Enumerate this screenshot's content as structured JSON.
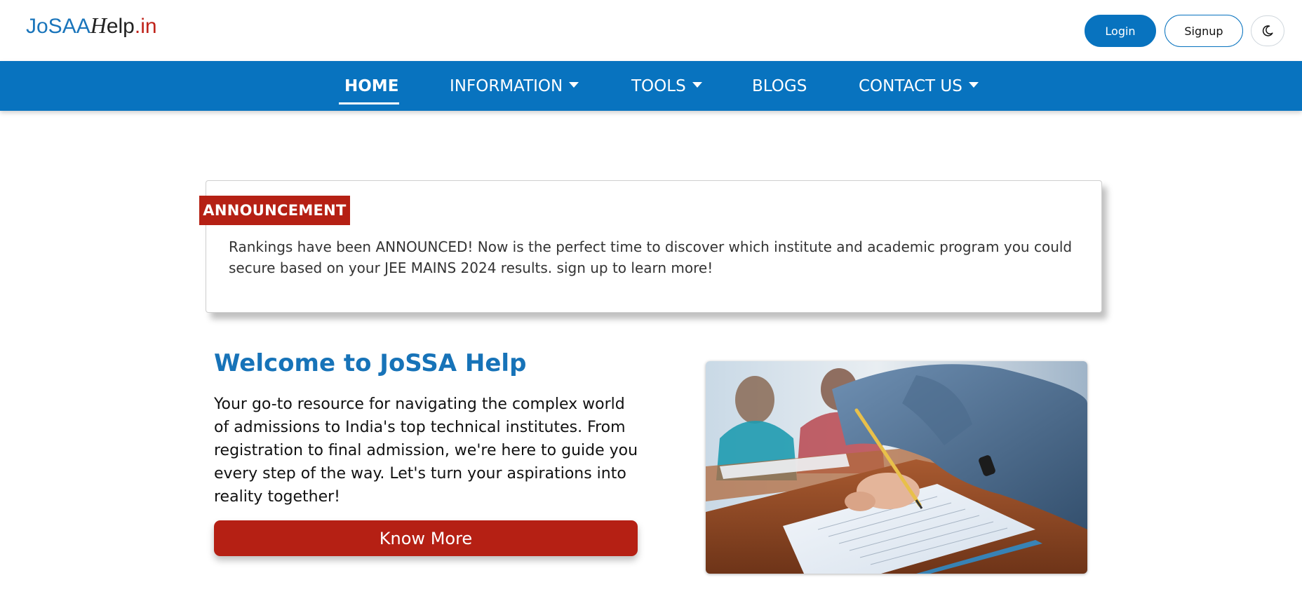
{
  "header": {
    "logo": {
      "part1": "JoSAA",
      "part2": "H",
      "part3": "elp",
      "part4": ".in"
    },
    "login_label": "Login",
    "signup_label": "Signup",
    "theme_icon": "moon-icon"
  },
  "nav": {
    "items": [
      {
        "label": "HOME",
        "active": true,
        "dropdown": false
      },
      {
        "label": "INFORMATION",
        "dropdown": true
      },
      {
        "label": "TOOLS",
        "dropdown": true
      },
      {
        "label": "BLOGS",
        "dropdown": false
      },
      {
        "label": "CONTACT US",
        "dropdown": true
      }
    ]
  },
  "announcement": {
    "tag": "ANNOUNCEMENT",
    "text": "Rankings have been ANNOUNCED! Now is the perfect time to discover which institute and academic program you could secure based on your JEE MAINS 2024 results. sign up to learn more!"
  },
  "welcome": {
    "title": "Welcome to JoSSA Help",
    "text": "Your go-to resource for navigating the complex world of admissions to India's top technical institutes. From registration to final admission, we're here to guide you every step of the way. Let's turn your aspirations into reality together!",
    "button_label": "Know More"
  },
  "colors": {
    "brand_blue": "#0873bf",
    "accent_red": "#b52014",
    "title_blue": "#1773b8"
  }
}
